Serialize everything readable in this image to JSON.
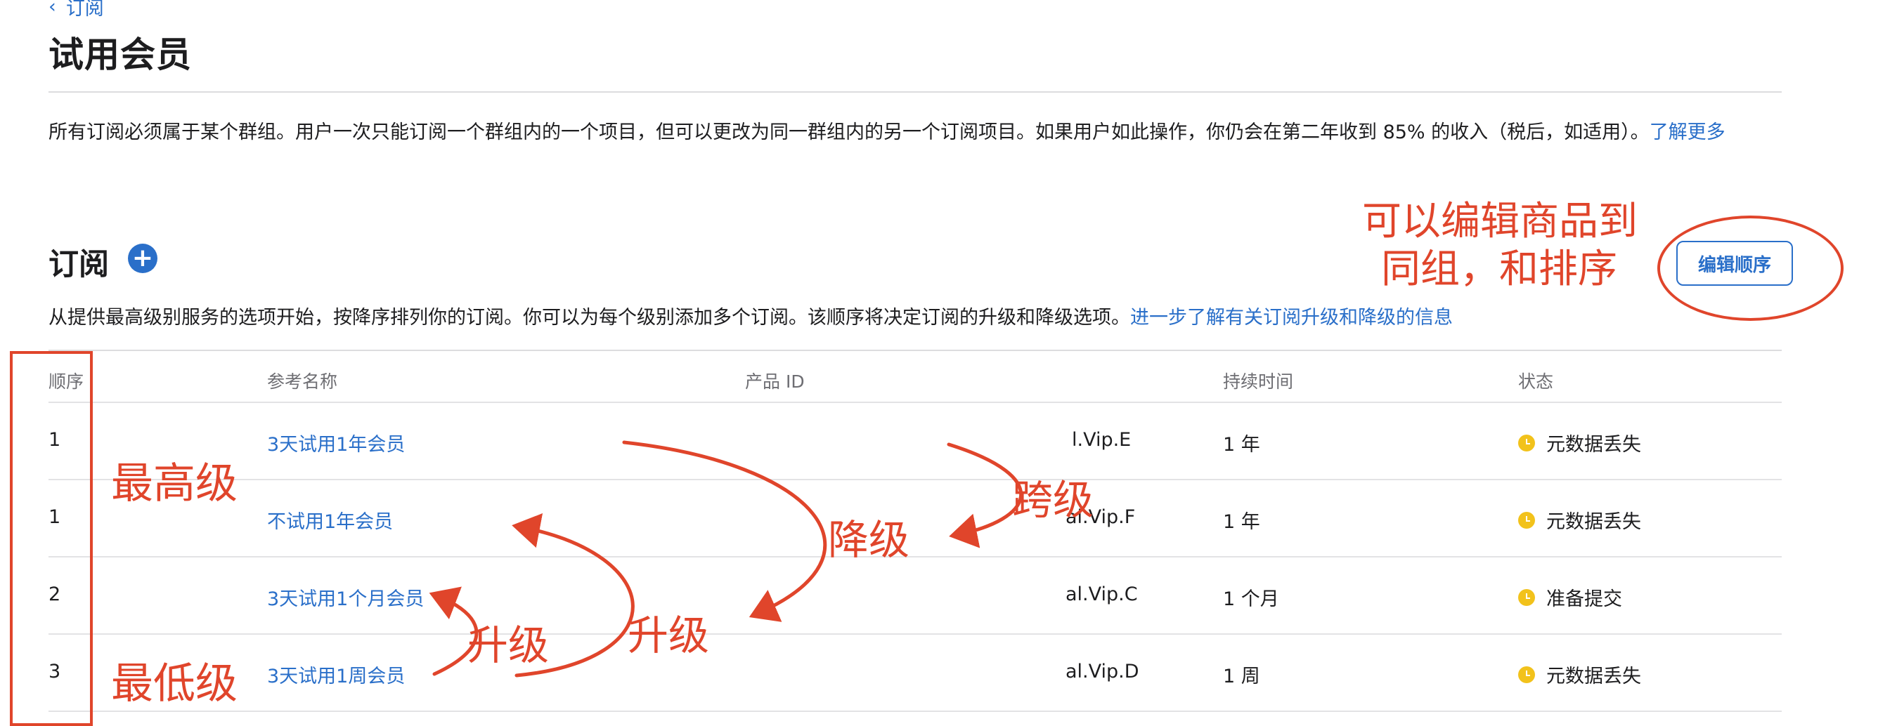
{
  "breadcrumb": {
    "back_label": "订阅"
  },
  "page_title": "试用会员",
  "description": {
    "text": "所有订阅必须属于某个群组。用户一次只能订阅一个群组内的一个项目，但可以更改为同一群组内的另一个订阅项目。如果用户如此操作，你仍会在第二年收到 85% 的收入（税后，如适用）。",
    "link": "了解更多"
  },
  "section": {
    "title": "订阅",
    "edit_order_label": "编辑顺序",
    "subtitle": "从提供最高级别服务的选项开始，按降序排列你的订阅。你可以为每个级别添加多个订阅。该顺序将决定订阅的升级和降级选项。",
    "subtitle_link": "进一步了解有关订阅升级和降级的信息"
  },
  "table": {
    "headers": [
      "顺序",
      "参考名称",
      "产品 ID",
      "持续时间",
      "状态"
    ],
    "rows": [
      {
        "order": "1",
        "name": "3天试用1年会员",
        "product_id": "l.Vip.E",
        "duration": "1 年",
        "status": "元数据丢失"
      },
      {
        "order": "1",
        "name": "不试用1年会员",
        "product_id": "al.Vip.F",
        "duration": "1 年",
        "status": "元数据丢失"
      },
      {
        "order": "2",
        "name": "3天试用1个月会员",
        "product_id": "al.Vip.C",
        "duration": "1 个月",
        "status": "准备提交"
      },
      {
        "order": "3",
        "name": "3天试用1周会员",
        "product_id": "al.Vip.D",
        "duration": "1 周",
        "status": "元数据丢失"
      }
    ]
  },
  "annotations": {
    "edit_note_line1": "可以编辑商品到",
    "edit_note_line2": "同组，和排序",
    "highest": "最高级",
    "lowest": "最低级",
    "downgrade": "降级",
    "cross_grade": "跨级",
    "upgrade_1": "升级",
    "upgrade_2": "升级"
  },
  "colors": {
    "link": "#2a6fc9",
    "annotation": "#e0452b",
    "status_dot": "#f2c21b"
  }
}
